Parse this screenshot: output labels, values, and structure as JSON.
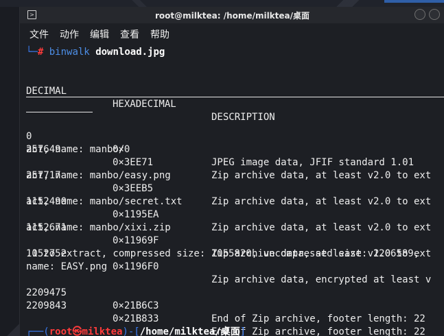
{
  "window": {
    "title": "root@milktea: /home/milktea/桌面",
    "terminal_icon": "terminal-icon"
  },
  "menu": {
    "items": [
      "文件",
      "动作",
      "编辑",
      "查看",
      "帮助"
    ]
  },
  "command": {
    "corner": "└─",
    "hash": "#",
    "program": "binwalk",
    "argument": "download.jpg"
  },
  "headers": {
    "decimal": "DECIMAL",
    "hexadecimal": "HEXADECIMAL",
    "description": "DESCRIPTION"
  },
  "rows": [
    {
      "decimal": "0",
      "hex": "0×0",
      "desc": "JPEG image data, JFIF standard 1.01"
    },
    {
      "decimal": "257649",
      "hex": "0×3EE71",
      "desc": "Zip archive data, at least v2.0 to ext"
    },
    {
      "wrap": "act, name: manbo/"
    },
    {
      "decimal": "257717",
      "hex": "0×3EEB5",
      "desc": "Zip archive data, at least v2.0 to ext"
    },
    {
      "wrap": "act, name: manbo/easy.png"
    },
    {
      "decimal": "1152490",
      "hex": "0×1195EA",
      "desc": "Zip archive data, at least v2.0 to ext"
    },
    {
      "wrap": "act, name: manbo/secret.txt"
    },
    {
      "decimal": "1152671",
      "hex": "0×11969F",
      "desc": "Zip archive data, at least v2.0 to ext"
    },
    {
      "wrap": "act, name: manbo/xixi.zip"
    },
    {
      "decimal": "1152752",
      "hex": "0×1196F0",
      "desc": "Zip archive data, encrypted at least v"
    },
    {
      "wrap": ".0 to extract, compressed size: 1055820, uncompressed size: 1206589,"
    },
    {
      "wrap": "name: EASY.png"
    },
    {
      "decimal": "2209475",
      "hex": "0×21B6C3",
      "desc": "End of Zip archive, footer length: 22"
    },
    {
      "decimal": "2209843",
      "hex": "0×21B833",
      "desc": "End of Zip archive, footer length: 22"
    }
  ],
  "prompt": {
    "open": "┌──(",
    "user": "root",
    "at": "㉿",
    "host": "milktea",
    "mid": ")-[",
    "path": "/home/milktea/桌面",
    "close": "]",
    "corner": "└─",
    "hash": "#"
  },
  "colors": {
    "background": "#1d1f24",
    "prompt_blue": "#3a7bf0",
    "prompt_red": "#ff3b3b",
    "text": "#eeeeee"
  }
}
